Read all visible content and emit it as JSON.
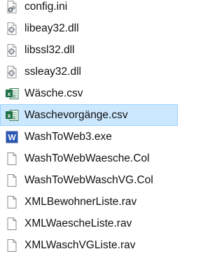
{
  "files": [
    {
      "name": "config.ini",
      "icon": "config-ini-icon",
      "selected": false
    },
    {
      "name": "libeay32.dll",
      "icon": "dll-icon",
      "selected": false
    },
    {
      "name": "libssl32.dll",
      "icon": "dll-icon",
      "selected": false
    },
    {
      "name": "ssleay32.dll",
      "icon": "dll-icon",
      "selected": false
    },
    {
      "name": "Wäsche.csv",
      "icon": "excel-csv-icon",
      "selected": false
    },
    {
      "name": "Waschevorgänge.csv",
      "icon": "excel-csv-icon",
      "selected": true
    },
    {
      "name": "WashToWeb3.exe",
      "icon": "exe-app-icon",
      "selected": false
    },
    {
      "name": "WashToWebWaesche.Col",
      "icon": "blank-file-icon",
      "selected": false
    },
    {
      "name": "WashToWebWaschVG.Col",
      "icon": "blank-file-icon",
      "selected": false
    },
    {
      "name": "XMLBewohnerListe.rav",
      "icon": "blank-file-icon",
      "selected": false
    },
    {
      "name": "XMLWaescheListe.rav",
      "icon": "blank-file-icon",
      "selected": false
    },
    {
      "name": "XMLWaschVGListe.rav",
      "icon": "blank-file-icon",
      "selected": false
    }
  ],
  "colors": {
    "selection_bg": "#cce8ff",
    "selection_border": "#99d1ff",
    "excel_green": "#1e7145",
    "exe_blue": "#1f4fb4"
  }
}
